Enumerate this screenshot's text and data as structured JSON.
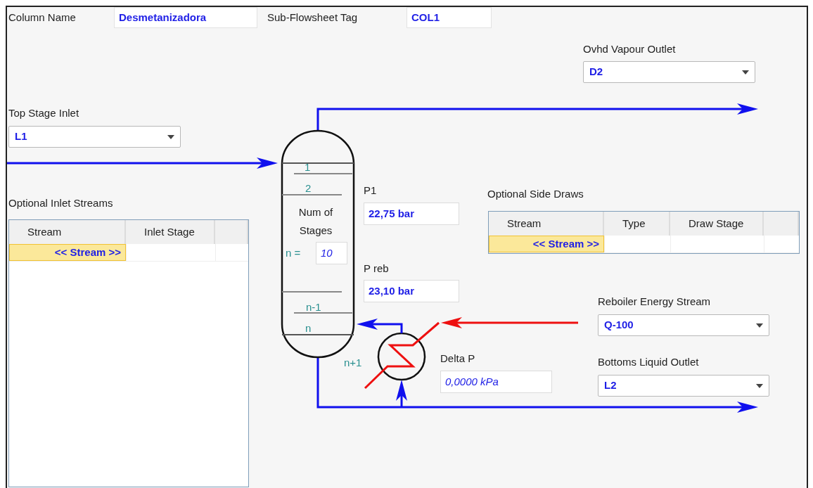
{
  "header": {
    "column_name": {
      "label": "Column Name",
      "value": "Desmetanizadora"
    },
    "subflowsheet_tag": {
      "label": "Sub-Flowsheet Tag",
      "value": "COL1"
    }
  },
  "ovhd_vapour_outlet": {
    "label": "Ovhd Vapour Outlet",
    "value": "D2"
  },
  "top_stage_inlet": {
    "label": "Top Stage Inlet",
    "value": "L1"
  },
  "column": {
    "top_stages": [
      "1",
      "2"
    ],
    "num_stages_label": "Num of Stages",
    "n_label": "n =",
    "n_value": "10",
    "bottom_stages": [
      "n-1",
      "n"
    ],
    "reboiler_stage": "n+1"
  },
  "p1": {
    "label": "P1",
    "value": "22,75 bar"
  },
  "p_reb": {
    "label": "P reb",
    "value": "23,10 bar"
  },
  "reboiler_energy_stream": {
    "label": "Reboiler Energy Stream",
    "value": "Q-100"
  },
  "delta_p": {
    "label": "Delta P",
    "value": "0,0000 kPa"
  },
  "bottoms_liquid_outlet": {
    "label": "Bottoms Liquid Outlet",
    "value": "L2"
  },
  "inlet_streams": {
    "title": "Optional Inlet Streams",
    "columns": [
      "Stream",
      "Inlet Stage"
    ],
    "rows": [
      {
        "stream": "<< Stream >>",
        "selected": true
      }
    ]
  },
  "side_draws": {
    "title": "Optional Side Draws",
    "columns": [
      "Stream",
      "Type",
      "Draw Stage"
    ],
    "rows": [
      {
        "stream": "<< Stream >>",
        "selected": true
      }
    ]
  }
}
